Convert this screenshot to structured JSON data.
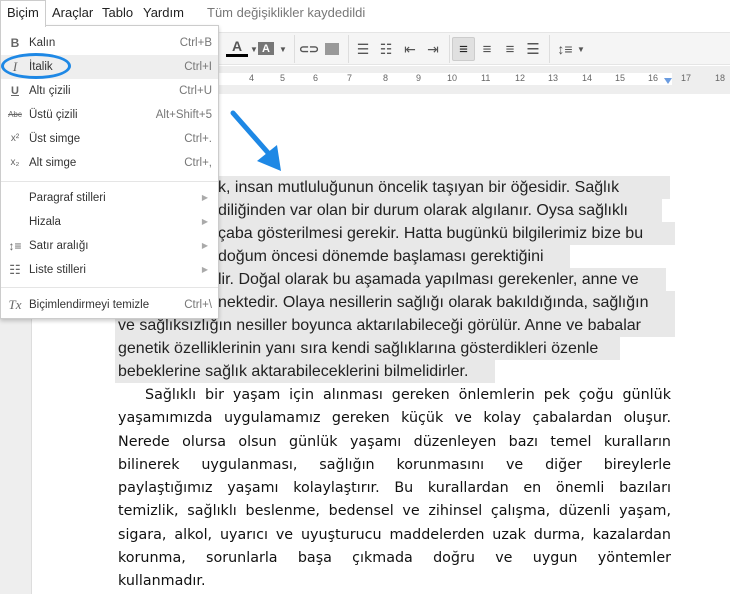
{
  "menubar": {
    "items": [
      "Biçim",
      "Araçlar",
      "Tablo",
      "Yardım"
    ],
    "status": "Tüm değişiklikler kaydedildi"
  },
  "toolbar": {
    "text_color": "A",
    "highlight": "A",
    "active_align": "left"
  },
  "ruler": {
    "numbers": [
      "4",
      "5",
      "6",
      "7",
      "8",
      "9",
      "10",
      "11",
      "12",
      "13",
      "14",
      "15",
      "16",
      "17",
      "18"
    ]
  },
  "menu": {
    "items": [
      {
        "icon": "B",
        "label": "Kalın",
        "shortcut": "Ctrl+B"
      },
      {
        "icon": "I",
        "label": "İtalik",
        "shortcut": "Ctrl+I"
      },
      {
        "icon": "U",
        "label": "Altı çizili",
        "shortcut": "Ctrl+U"
      },
      {
        "icon": "Abc",
        "label": "Üstü çizili",
        "shortcut": "Alt+Shift+5"
      },
      {
        "icon": "x²",
        "label": "Üst simge",
        "shortcut": "Ctrl+."
      },
      {
        "icon": "x₂",
        "label": "Alt simge",
        "shortcut": "Ctrl+,"
      },
      {
        "label": "Paragraf stilleri"
      },
      {
        "label": "Hizala"
      },
      {
        "label": "Satır aralığı"
      },
      {
        "label": "Liste stilleri"
      },
      {
        "label": "Biçimlendirmeyi temizle",
        "shortcut": "Ctrl+\\"
      }
    ],
    "highlighted": "İtalik",
    "annotation_color": "#1e88e5"
  },
  "document": {
    "selected_lines": [
      "k, insan mutluluğunun öncelik taşıyan bir öğesidir. Sağlık",
      "diliğinden var olan bir durum olarak algılanır. Oysa sağlıklı",
      "çaba gösterilmesi gerekir. Hatta bugünkü bilgilerimiz bize bu",
      "doğum öncesi dönemde başlaması gerektiğini",
      "lir. Doğal olarak bu aşamada yapılması gerekenler, anne ve",
      "nektedir. Olaya nesillerin sağlığı olarak bakıldığında, sağlığın",
      "ve sağlıksızlığın nesiller boyunca aktarılabileceği görülür. Anne ve babalar",
      "genetik özelliklerinin yanı sıra kendi sağlıklarına gösterdikleri özenle",
      "bebeklerine sağlık aktarabileceklerini bilmelidirler."
    ],
    "paragraph2": [
      "Sağlıklı bir yaşam için alınması gereken önlemlerin pek çoğu günlük",
      "yaşamımızda  uygulamamız gereken küçük ve kolay çabalardan oluşur.",
      "Nerede olursa olsun günlük yaşamı düzenleyen bazı temel kuralların",
      "bilinerek uygulanması, sağlığın korunmasını ve diğer bireylerle",
      "paylaştığımız yaşamı kolaylaştırır. Bu kurallardan en önemli bazıları",
      "temizlik, sağlıklı beslenme, bedensel ve zihinsel çalışma, düzenli yaşam,",
      "sigara, alkol, uyarıcı ve uyuşturucu maddelerden uzak durma, kazalardan",
      "korunma, sorunlarla başa çıkmada doğru ve uygun yöntemler",
      "kullanmadır."
    ]
  }
}
